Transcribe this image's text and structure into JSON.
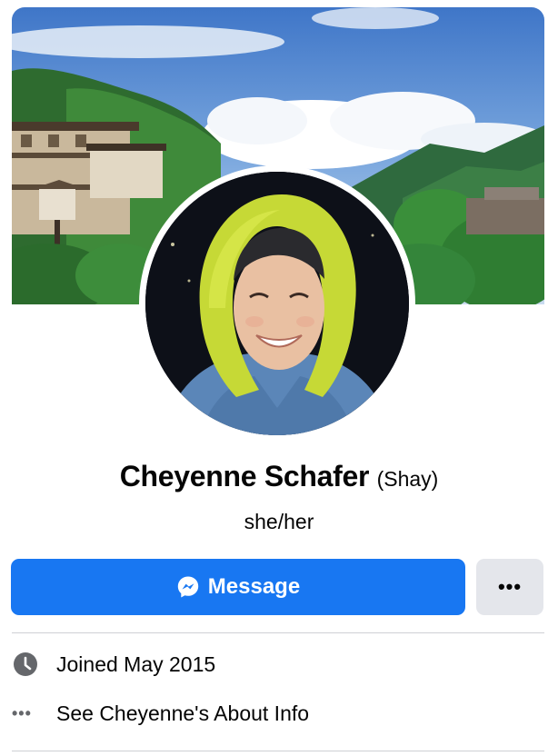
{
  "profile": {
    "name": "Cheyenne Schafer",
    "nickname": "(Shay)",
    "pronouns": "she/her"
  },
  "actions": {
    "message_label": "Message",
    "more_label": "•••"
  },
  "info": {
    "joined": "Joined May 2015",
    "about_link": "See Cheyenne's About Info",
    "about_icon_label": "•••"
  },
  "icons": {
    "message": "messenger-icon",
    "joined": "clock-icon",
    "about": "more-dots-icon"
  },
  "colors": {
    "primary": "#1877f2",
    "secondary_button": "#e4e6eb",
    "text": "#050505",
    "secondary_text": "#65676b",
    "divider": "#ced0d4"
  }
}
